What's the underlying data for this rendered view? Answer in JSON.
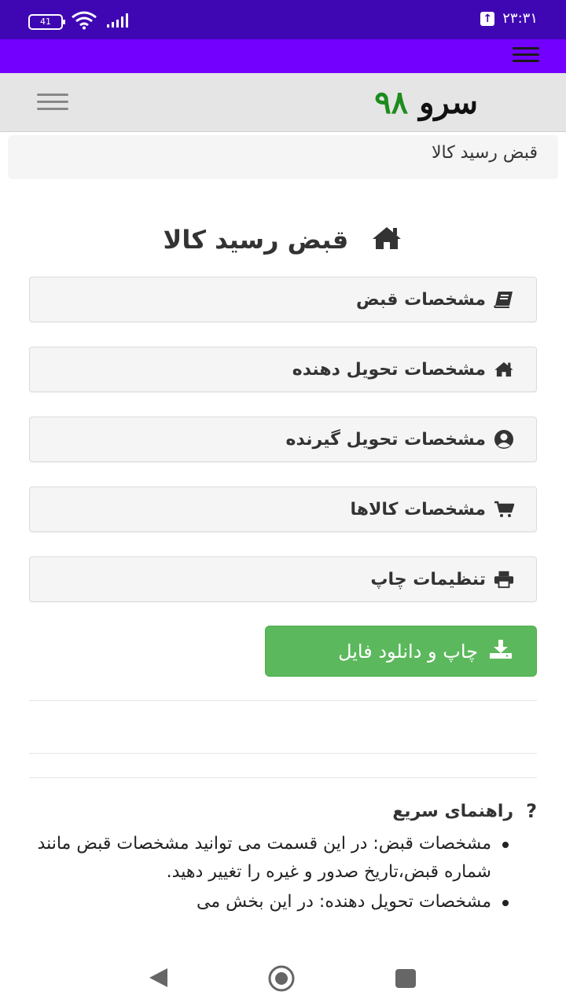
{
  "status_bar": {
    "battery": "41",
    "time": "۲۳:۳۱"
  },
  "header": {
    "logo_text": "سرو",
    "logo_number": "۹۸"
  },
  "breadcrumb": {
    "current": "قبض رسید کالا"
  },
  "page": {
    "title": "قبض رسید کالا"
  },
  "sections": [
    {
      "label": "مشخصات قبض",
      "icon": "book-icon"
    },
    {
      "label": "مشخصات تحویل دهنده",
      "icon": "home-icon"
    },
    {
      "label": "مشخصات تحویل گیرنده",
      "icon": "user-circle-icon"
    },
    {
      "label": "مشخصات کالاها",
      "icon": "cart-icon"
    },
    {
      "label": "تنظیمات چاپ",
      "icon": "printer-icon"
    }
  ],
  "download_button": {
    "label": "چاپ و دانلود فایل"
  },
  "guide": {
    "title": "راهنمای سریع",
    "items": [
      "مشخصات قبض: در این قسمت می توانید مشخصات قبض مانند شماره قبض،تاریخ صدور و غیره را تغییر دهید.",
      "مشخصات تحویل دهنده: در این بخش می"
    ]
  },
  "colors": {
    "status_bar": "#3f07b3",
    "top_bar": "#7300ff",
    "accent_green": "#5cb85c",
    "logo_number": "#1c8c1c"
  }
}
